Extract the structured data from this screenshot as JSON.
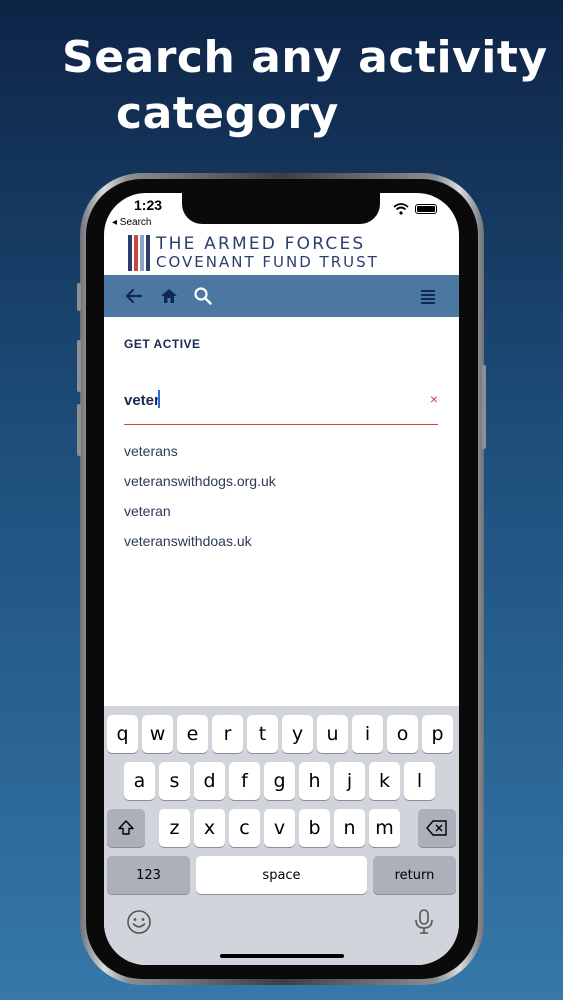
{
  "headline": {
    "line1": "Search any activity",
    "line2": "category"
  },
  "status_bar": {
    "time": "1:23",
    "back_label": "◂ Search"
  },
  "logo": {
    "line1": "THE ARMED FORCES",
    "line2": "COVENANT FUND TRUST",
    "stripe_colors": [
      "#2b3f6e",
      "#c9473d",
      "#8fa2c8",
      "#2b3f6e"
    ]
  },
  "nav": {
    "back_icon": "arrow-left-icon",
    "home_icon": "home-icon",
    "search_icon": "search-icon",
    "menu_icon": "menu-icon"
  },
  "page": {
    "section_title": "GET ACTIVE"
  },
  "search": {
    "value": "veter",
    "clear_glyph": "×"
  },
  "suggestions": [
    "veterans",
    "veteranswithdogs.org.uk",
    "veteran",
    "veteranswithdoas.uk"
  ],
  "keyboard": {
    "row1": [
      "q",
      "w",
      "e",
      "r",
      "t",
      "y",
      "u",
      "i",
      "o",
      "p"
    ],
    "row2": [
      "a",
      "s",
      "d",
      "f",
      "g",
      "h",
      "j",
      "k",
      "l"
    ],
    "row3": [
      "z",
      "x",
      "c",
      "v",
      "b",
      "n",
      "m"
    ],
    "numbers_label": "123",
    "space_label": "space",
    "return_label": "return",
    "emoji_icon": "emoji-icon",
    "mic_icon": "microphone-icon"
  },
  "colors": {
    "navbar": "#4c77a0",
    "brand_navy": "#2b3f6e",
    "accent_red": "#c9473d"
  }
}
